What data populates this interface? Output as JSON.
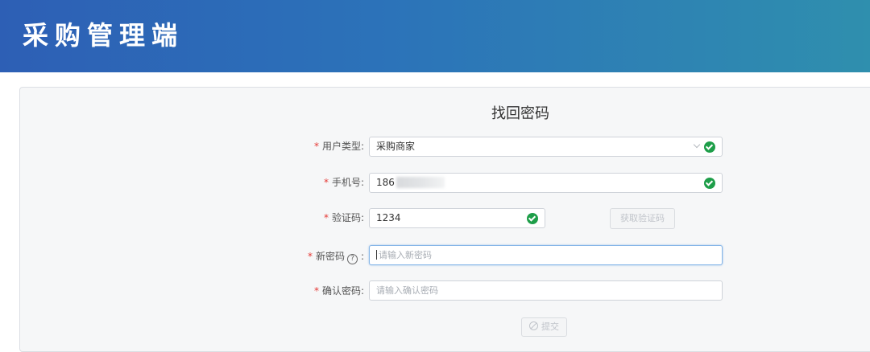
{
  "header": {
    "app_title": "采购管理端",
    "gradient_start": "#2d5fb5",
    "gradient_end": "#2f8fae"
  },
  "form": {
    "title": "找回密码",
    "required_mark": "*",
    "user_type": {
      "label": "用户类型:",
      "value": "采购商家",
      "valid": true
    },
    "phone": {
      "label": "手机号:",
      "value_prefix": "186",
      "masked": true,
      "valid": true
    },
    "code": {
      "label": "验证码:",
      "value": "1234",
      "valid": true
    },
    "get_code_button": "获取验证码",
    "new_password": {
      "label": "新密码",
      "help_glyph": "?",
      "colon": ":",
      "placeholder": "请输入新密码",
      "focused": true
    },
    "confirm_password": {
      "label": "确认密码:",
      "placeholder": "请输入确认密码"
    },
    "submit_button": "提交",
    "accent_valid": "#1e9e49",
    "accent_required": "#e53935"
  }
}
